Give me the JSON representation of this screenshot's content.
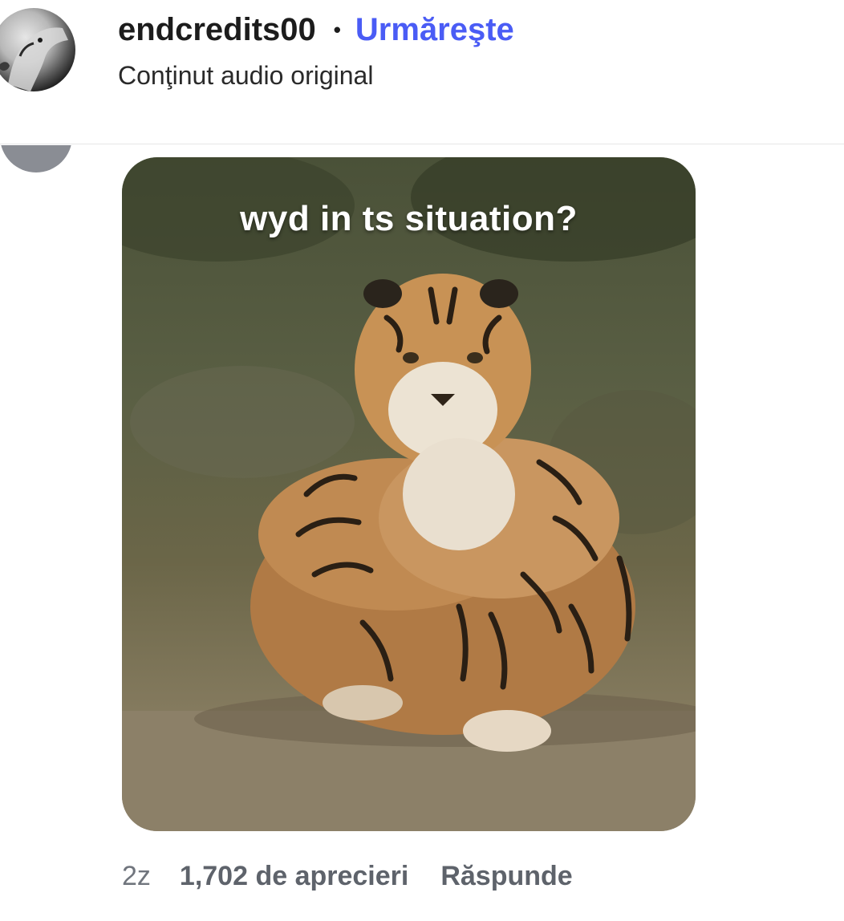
{
  "post_header": {
    "username": "endcredits00",
    "separator": "•",
    "follow_label": "Urmăreşte",
    "audio_label": "Conţinut audio original"
  },
  "comment": {
    "gif": {
      "caption": "wyd in ts situation?"
    },
    "timestamp": "2z",
    "likes_label": "1,702 de aprecieri",
    "reply_label": "Răspunde"
  },
  "colors": {
    "follow_link": "#4a5cf5",
    "meta_text": "#5e636b"
  }
}
